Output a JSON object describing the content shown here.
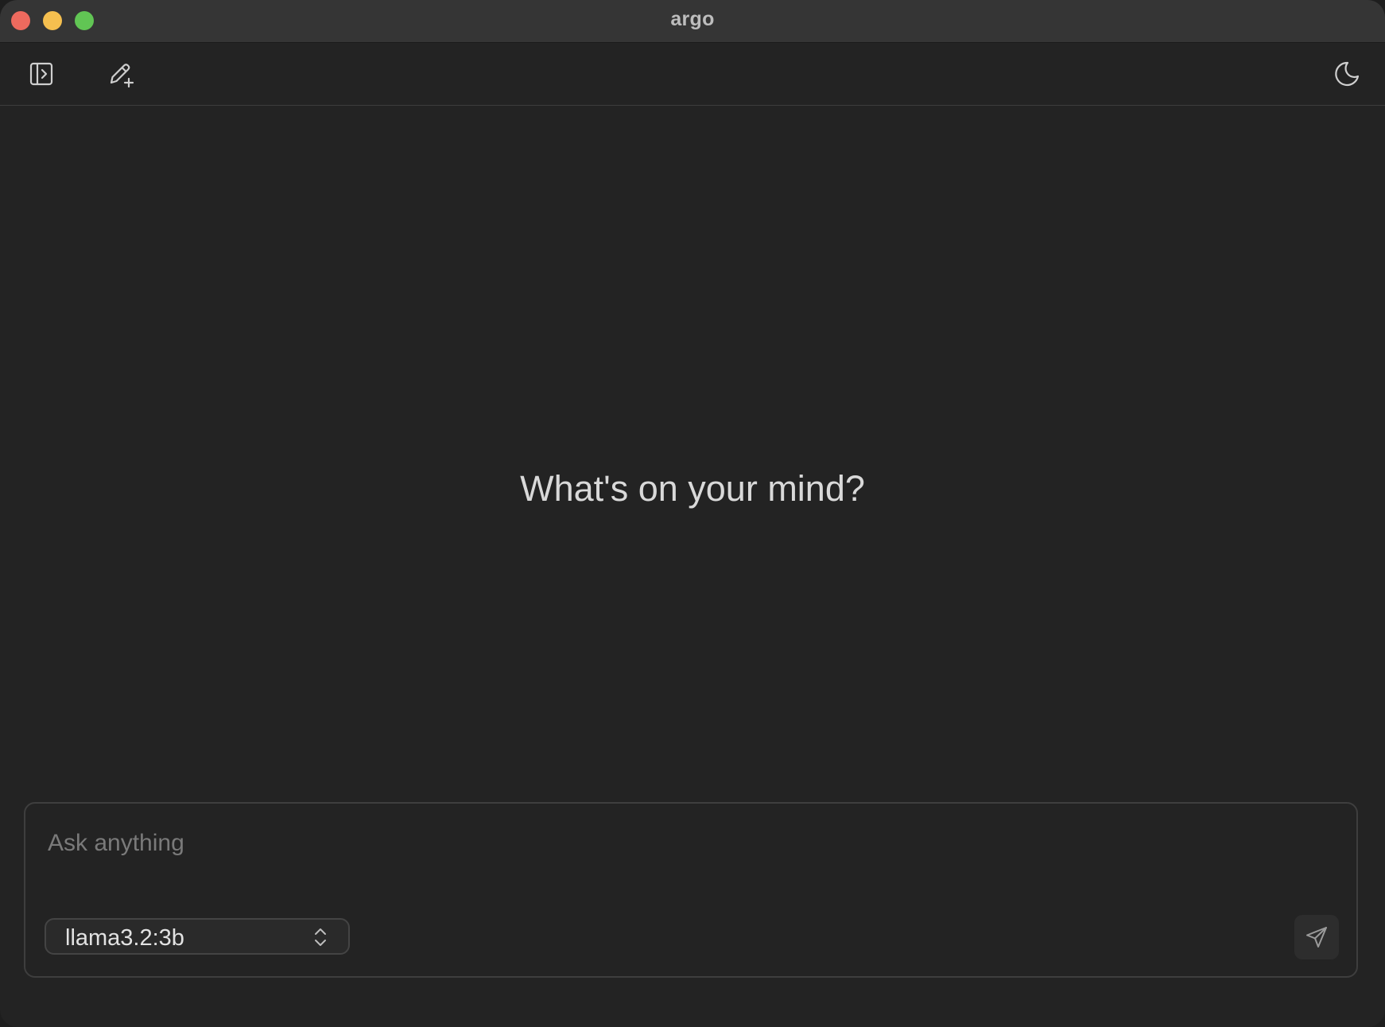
{
  "window": {
    "title": "argo"
  },
  "toolbar": {
    "sidebar_toggle_icon": "sidebar-toggle-icon",
    "new_chat_icon": "new-chat-icon",
    "theme_icon": "moon-icon"
  },
  "main": {
    "greeting": "What's on your mind?"
  },
  "composer": {
    "placeholder": "Ask anything",
    "value": "",
    "model_selected": "llama3.2:3b",
    "send_icon": "send-icon"
  },
  "colors": {
    "close": "#ed6a5e",
    "minimize": "#f5bf4f",
    "maximize": "#61c554",
    "background": "#232323",
    "titlebar": "#353535"
  }
}
